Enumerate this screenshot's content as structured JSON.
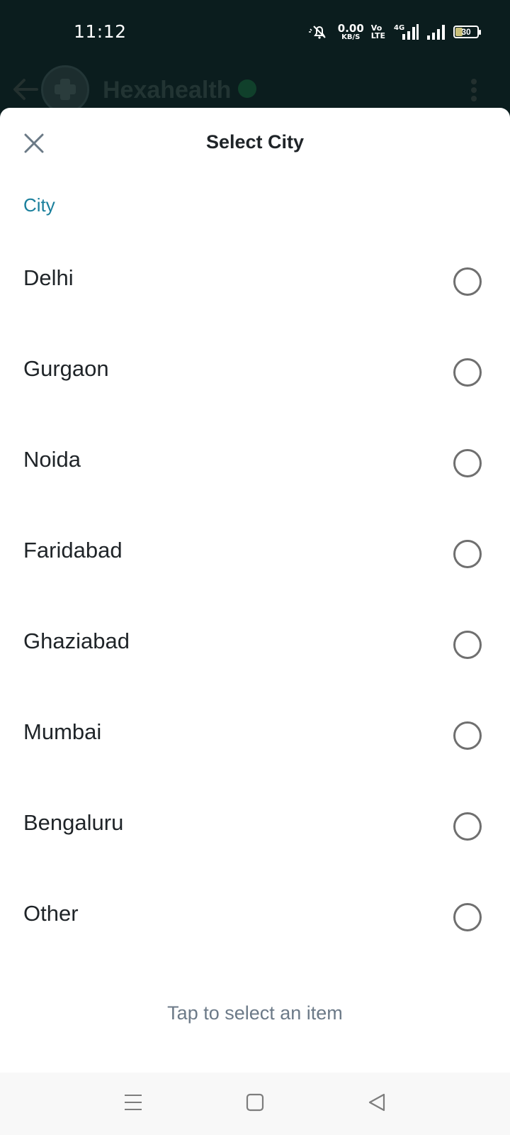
{
  "status_bar": {
    "time": "11:12",
    "net_speed_value": "0.00",
    "net_speed_unit": "KB/S",
    "volte_top": "Vo",
    "volte_bottom": "LTE",
    "network_label": "4G",
    "battery_level": "30",
    "battery_fill_fraction": 0.3
  },
  "app_header": {
    "name": "Hexahealth"
  },
  "sheet": {
    "title": "Select City",
    "section_label": "City",
    "options": [
      {
        "label": "Delhi",
        "selected": false
      },
      {
        "label": "Gurgaon",
        "selected": false
      },
      {
        "label": "Noida",
        "selected": false
      },
      {
        "label": "Faridabad",
        "selected": false
      },
      {
        "label": "Ghaziabad",
        "selected": false
      },
      {
        "label": "Mumbai",
        "selected": false
      },
      {
        "label": "Bengaluru",
        "selected": false
      },
      {
        "label": "Other",
        "selected": false
      }
    ],
    "hint": "Tap to select an item"
  },
  "colors": {
    "accent": "#1a7f9c",
    "dark_background": "#0b1d1e",
    "text_primary": "#1f2428",
    "text_hint": "#6c7a88",
    "radio_border": "#6f6f6f"
  },
  "icons": {
    "close": "close-icon",
    "back": "arrow-left-icon",
    "menu": "more-vertical-icon",
    "bell_muted": "bell-off-icon",
    "signal": "signal-bars-icon",
    "nav_recents": "menu-lines-icon",
    "nav_home": "square-icon",
    "nav_back": "triangle-back-icon"
  }
}
